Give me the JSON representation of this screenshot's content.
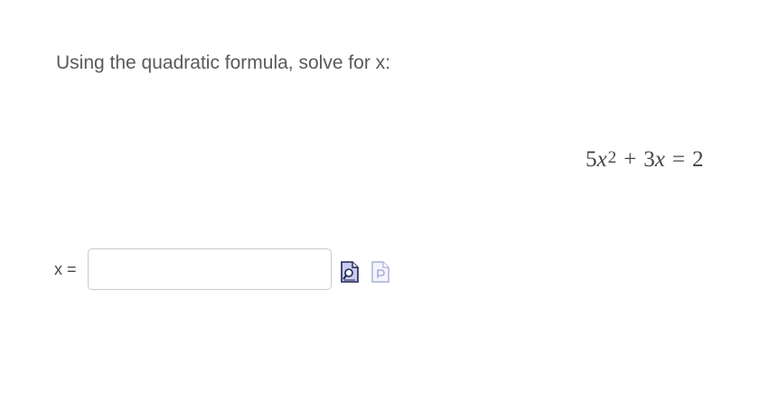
{
  "question": {
    "prompt": "Using the quadratic formula, solve for x:",
    "equation": {
      "coef_a": "5",
      "var": "x",
      "exponent": "2",
      "plus": "+",
      "coef_b": "3",
      "equals": "=",
      "rhs": "2"
    }
  },
  "answer": {
    "label": "x =",
    "value": "",
    "placeholder": ""
  },
  "tools": {
    "preview_icon": "preview-document-icon",
    "print_icon": "print-document-icon",
    "accent": "#3d4a8c"
  }
}
